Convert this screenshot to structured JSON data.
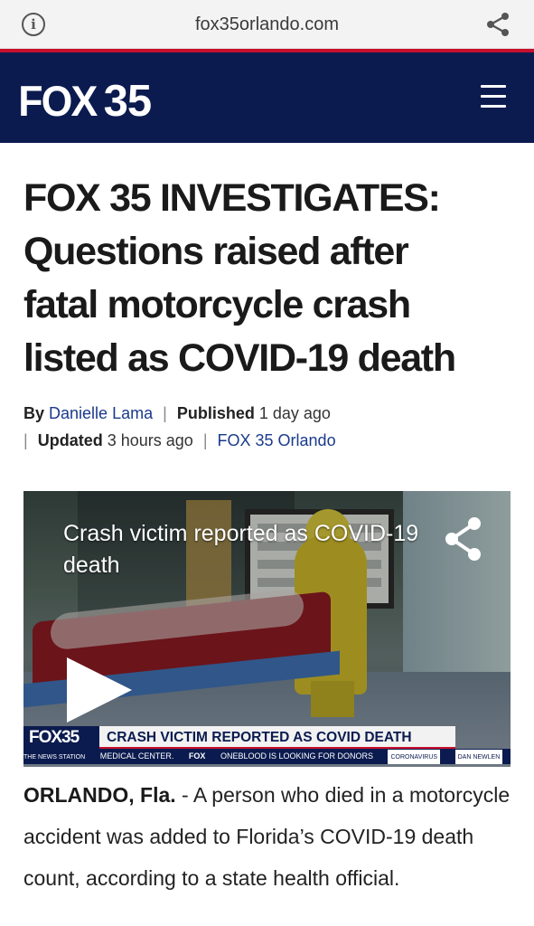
{
  "browser": {
    "url": "fox35orlando.com",
    "info_icon": "info-icon",
    "share_icon": "share-icon"
  },
  "header": {
    "logo_fox": "FOX",
    "logo_num": "35",
    "menu_icon": "hamburger-menu-icon",
    "colors": {
      "navy": "#0b1b4f",
      "red": "#c8102e"
    }
  },
  "article": {
    "headline_lines": [
      "FOX 35 INVESTIGATES:",
      "Questions raised after",
      "fatal motorcycle crash",
      "listed as COVID-19 death"
    ],
    "byline": {
      "by_label": "By",
      "author": "Danielle Lama",
      "published_label": "Published",
      "published_value": "1 day ago",
      "updated_label": "Updated",
      "updated_value": "3 hours ago",
      "source": "FOX 35 Orlando"
    },
    "video": {
      "title": "Crash victim reported as COVID-19 death",
      "lower_third_logo": "FOX35",
      "lower_third_headline": "CRASH VICTIM REPORTED AS COVID DEATH",
      "ticker_station": "THE NEWS STATION",
      "ticker_1": "MEDICAL CENTER.",
      "ticker_fox": "FOX",
      "ticker_2": "ONEBLOOD IS LOOKING FOR DONORS",
      "ticker_tag": "CORONAVIRUS",
      "ticker_anchor": "DAN NEWLEN"
    },
    "dateline": "ORLANDO, Fla.",
    "dateline_sep": " - ",
    "body": "A person who died in a motorcycle accident was added to Florida’s COVID-19 death count, according to a state health official."
  }
}
